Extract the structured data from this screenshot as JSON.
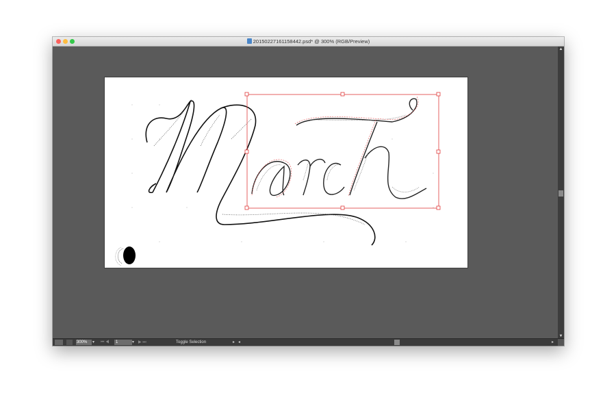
{
  "window": {
    "title": "20150227161158442.psd* @ 300% (RGB/Preview)"
  },
  "artboard": {
    "artwork_text": "March"
  },
  "statusbar": {
    "zoom": "300%",
    "page": "1",
    "mode_label": "Toggle Selection"
  },
  "icons": {
    "close": "traffic-close-icon",
    "minimize": "traffic-minimize-icon",
    "maximize": "traffic-maximize-icon"
  },
  "colors": {
    "selection": "#e03a3a",
    "canvas": "#5a5a5a",
    "artboard": "#ffffff"
  }
}
